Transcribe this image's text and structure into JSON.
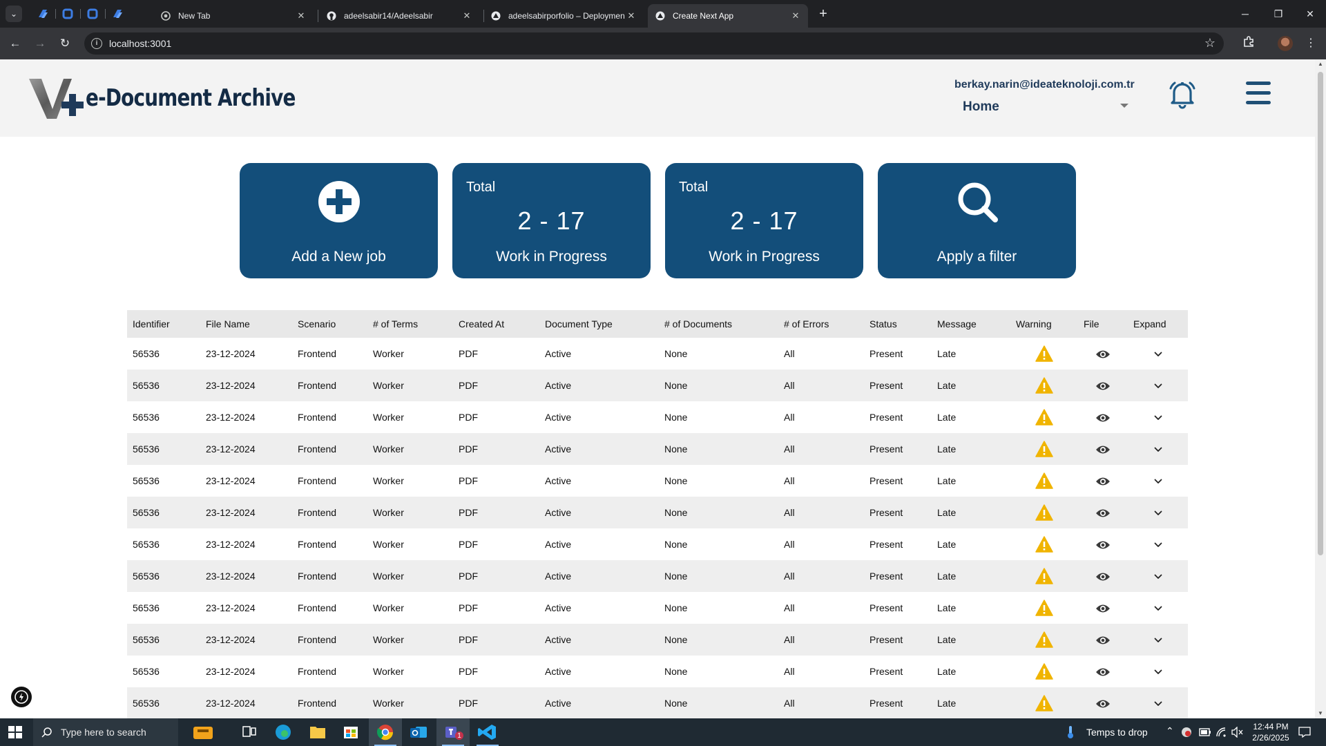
{
  "browser": {
    "tabs": [
      {
        "title": "New Tab",
        "active": false
      },
      {
        "title": "adeelsabir14/Adeelsabir",
        "active": false
      },
      {
        "title": "adeelsabirporfolio – Deploymen",
        "active": false
      },
      {
        "title": "Create Next App",
        "active": true
      }
    ],
    "url": "localhost:3001"
  },
  "app": {
    "brand": "e-Document Archive",
    "user_email": "berkay.narin@ideateknoloji.com.tr",
    "nav_selected": "Home"
  },
  "cards": [
    {
      "kind": "action",
      "icon": "plus-circle-icon",
      "label": "Add a New job"
    },
    {
      "kind": "stat",
      "total_label": "Total",
      "value": "2 - 17",
      "label": "Work in Progress"
    },
    {
      "kind": "stat",
      "total_label": "Total",
      "value": "2 - 17",
      "label": "Work in Progress"
    },
    {
      "kind": "action",
      "icon": "search-icon",
      "label": "Apply a filter"
    }
  ],
  "table": {
    "columns": [
      "Identifier",
      "File Name",
      "Scenario",
      "# of Terms",
      "Created At",
      "Document Type",
      "# of Documents",
      "# of Errors",
      "Status",
      "Message",
      "Warning",
      "File",
      "Expand"
    ],
    "rows": [
      [
        "56536",
        "23-12-2024",
        "Frontend",
        "Worker",
        "PDF",
        "Active",
        "None",
        "All",
        "Present",
        "Late"
      ],
      [
        "56536",
        "23-12-2024",
        "Frontend",
        "Worker",
        "PDF",
        "Active",
        "None",
        "All",
        "Present",
        "Late"
      ],
      [
        "56536",
        "23-12-2024",
        "Frontend",
        "Worker",
        "PDF",
        "Active",
        "None",
        "All",
        "Present",
        "Late"
      ],
      [
        "56536",
        "23-12-2024",
        "Frontend",
        "Worker",
        "PDF",
        "Active",
        "None",
        "All",
        "Present",
        "Late"
      ],
      [
        "56536",
        "23-12-2024",
        "Frontend",
        "Worker",
        "PDF",
        "Active",
        "None",
        "All",
        "Present",
        "Late"
      ],
      [
        "56536",
        "23-12-2024",
        "Frontend",
        "Worker",
        "PDF",
        "Active",
        "None",
        "All",
        "Present",
        "Late"
      ],
      [
        "56536",
        "23-12-2024",
        "Frontend",
        "Worker",
        "PDF",
        "Active",
        "None",
        "All",
        "Present",
        "Late"
      ],
      [
        "56536",
        "23-12-2024",
        "Frontend",
        "Worker",
        "PDF",
        "Active",
        "None",
        "All",
        "Present",
        "Late"
      ],
      [
        "56536",
        "23-12-2024",
        "Frontend",
        "Worker",
        "PDF",
        "Active",
        "None",
        "All",
        "Present",
        "Late"
      ],
      [
        "56536",
        "23-12-2024",
        "Frontend",
        "Worker",
        "PDF",
        "Active",
        "None",
        "All",
        "Present",
        "Late"
      ],
      [
        "56536",
        "23-12-2024",
        "Frontend",
        "Worker",
        "PDF",
        "Active",
        "None",
        "All",
        "Present",
        "Late"
      ],
      [
        "56536",
        "23-12-2024",
        "Frontend",
        "Worker",
        "PDF",
        "Active",
        "None",
        "All",
        "Present",
        "Late"
      ]
    ]
  },
  "taskbar": {
    "search_placeholder": "Type here to search",
    "weather": "Temps to drop",
    "time": "12:44 PM",
    "date": "2/26/2025",
    "outlook_badge": "1"
  },
  "colors": {
    "card_bg": "#134e7a",
    "header_bg": "#f3f3f3",
    "warning": "#f0b400",
    "row_alt": "#eeeeee"
  }
}
